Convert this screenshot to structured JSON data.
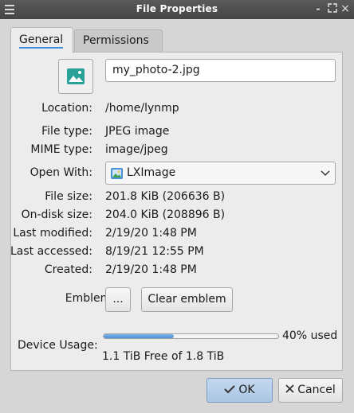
{
  "window": {
    "title": "File Properties",
    "controls": [
      "-",
      "×"
    ]
  },
  "tabs": [
    {
      "label": "General",
      "active": true
    },
    {
      "label": "Permissions",
      "active": false
    }
  ],
  "general": {
    "file_icon": "image-icon",
    "name_value": "my_photo-2.jpg",
    "location_label": "Location:",
    "location_value": "/home/lynmp",
    "file_type_label": "File type:",
    "file_type_value": "JPEG image",
    "mime_type_label": "MIME type:",
    "mime_type_value": "image/jpeg",
    "open_with_label": "Open With:",
    "open_with_value": "LXImage",
    "file_size_label": "File size:",
    "file_size_value": "201.8 KiB (206636 B)",
    "on_disk_size_label": "On-disk size:",
    "on_disk_size_value": "204.0 KiB (208896 B)",
    "last_modified_label": "Last modified:",
    "last_modified_value": "2/19/20 1:48 PM",
    "last_accessed_label": "Last accessed:",
    "last_accessed_value": "8/19/21 12:55 PM",
    "created_label": "Created:",
    "created_value": "2/19/20 1:48 PM",
    "emblem_label": "Emblem:",
    "emblem_choose_label": "...",
    "clear_emblem_label": "Clear emblem",
    "device_usage_label": "Device Usage:",
    "device_usage_fraction": 0.4,
    "device_usage_percent_text": "40% used",
    "device_free_text": "1.1 TiB Free of 1.8 TiB"
  },
  "buttons": {
    "ok_label": "OK",
    "cancel_label": "Cancel"
  },
  "colors": {
    "accent": "#3d8ee0",
    "image_icon": "#2aa198",
    "titlebar": "#4a4a4a"
  }
}
